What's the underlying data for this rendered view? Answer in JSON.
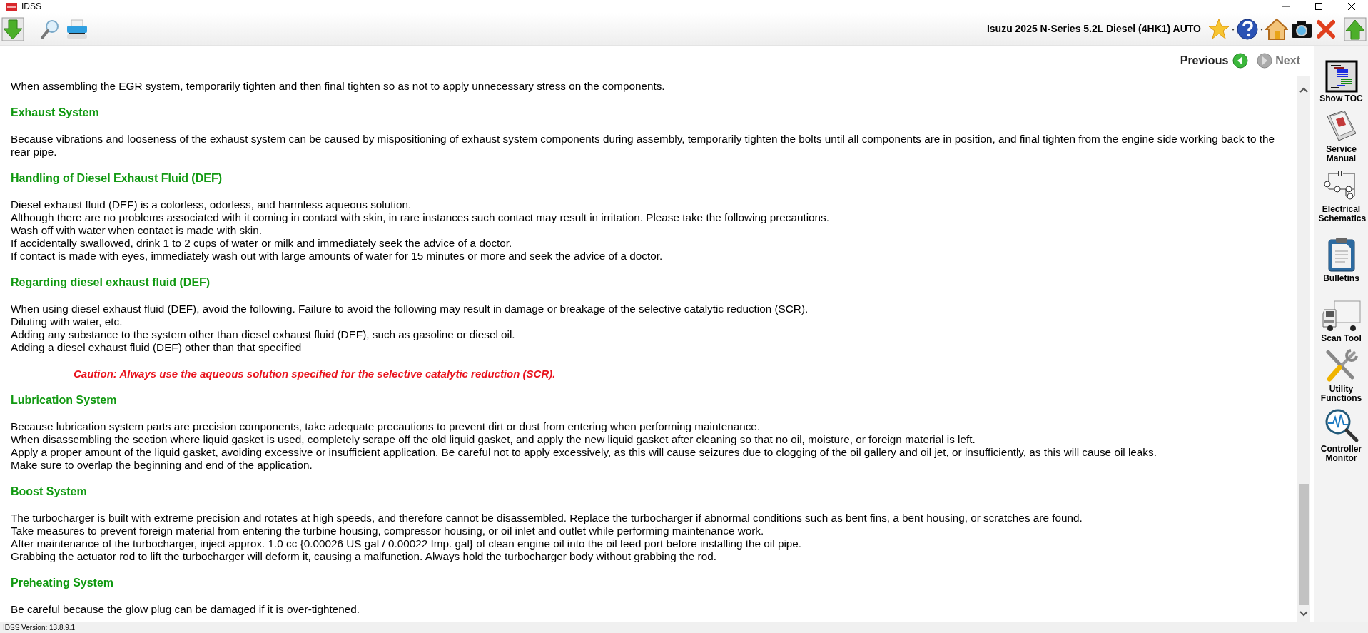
{
  "window": {
    "title": "IDSS"
  },
  "toolbar": {
    "vehicle": "Isuzu 2025 N-Series 5.2L Diesel (4HK1) AUTO"
  },
  "nav": {
    "previous": "Previous",
    "next": "Next",
    "next_disabled": true
  },
  "content": [
    {
      "kind": "paragraph",
      "lines": [
        "When assembling the EGR system, temporarily tighten and then final tighten so as not to apply unnecessary stress on the components."
      ]
    },
    {
      "kind": "heading",
      "text": "Exhaust System"
    },
    {
      "kind": "paragraph",
      "lines": [
        "Because vibrations and looseness of the exhaust system can be caused by mispositioning of exhaust system components during assembly, temporarily tighten the bolts until all components are in position, and final tighten from the engine side working back to the rear pipe."
      ]
    },
    {
      "kind": "heading",
      "text": "Handling of Diesel Exhaust Fluid (DEF)"
    },
    {
      "kind": "paragraph",
      "lines": [
        "Diesel exhaust fluid (DEF) is a colorless, odorless, and harmless aqueous solution.",
        "Although there are no problems associated with it coming in contact with skin, in rare instances such contact may result in irritation. Please take the following precautions.",
        "Wash off with water when contact is made with skin.",
        "If accidentally swallowed, drink 1 to 2 cups of water or milk and immediately seek the advice of a doctor.",
        "If contact is made with eyes, immediately wash out with large amounts of water for 15 minutes or more and seek the advice of a doctor."
      ]
    },
    {
      "kind": "heading",
      "text": "Regarding diesel exhaust fluid (DEF)"
    },
    {
      "kind": "paragraph",
      "lines": [
        "When using diesel exhaust fluid (DEF), avoid the following. Failure to avoid the following may result in damage or breakage of the selective catalytic reduction (SCR).",
        "Diluting with water, etc.",
        "Adding any substance to the system other than diesel exhaust fluid (DEF), such as gasoline or diesel oil.",
        "Adding a diesel exhaust fluid (DEF) other than that specified"
      ]
    },
    {
      "kind": "caution",
      "text": "Caution: Always use the aqueous solution specified for the selective catalytic reduction (SCR)."
    },
    {
      "kind": "heading",
      "text": "Lubrication System"
    },
    {
      "kind": "paragraph",
      "lines": [
        "Because lubrication system parts are precision components, take adequate precautions to prevent dirt or dust from entering when performing maintenance.",
        "When disassembling the section where liquid gasket is used, completely scrape off the old liquid gasket, and apply the new liquid gasket after cleaning so that no oil, moisture, or foreign material is left.",
        "Apply a proper amount of the liquid gasket, avoiding excessive or insufficient application. Be careful not to apply excessively, as this will cause seizures due to clogging of the oil gallery and oil jet, or insufficiently, as this will cause oil leaks.",
        "Make sure to overlap the beginning and end of the application."
      ]
    },
    {
      "kind": "heading",
      "text": "Boost System"
    },
    {
      "kind": "paragraph",
      "lines": [
        "The turbocharger is built with extreme precision and rotates at high speeds, and therefore cannot be disassembled. Replace the turbocharger if abnormal conditions such as bent fins, a bent housing, or scratches are found.",
        "Take measures to prevent foreign material from entering the turbine housing, compressor housing, or oil inlet and outlet while performing maintenance work.",
        "After maintenance of the turbocharger, inject approx. 1.0 cc {0.00026 US gal / 0.00022 Imp. gal} of clean engine oil into the oil feed port before installing the oil pipe.",
        "Grabbing the actuator rod to lift the turbocharger will deform it, causing a malfunction. Always hold the turbocharger body without grabbing the rod."
      ]
    },
    {
      "kind": "heading",
      "text": "Preheating System"
    },
    {
      "kind": "paragraph",
      "lines": [
        "Be careful because the glow plug can be damaged if it is over-tightened."
      ]
    }
  ],
  "sidebar": {
    "items": [
      {
        "kind": "toc",
        "label": "Show TOC"
      },
      {
        "kind": "manual",
        "label": "Service Manual"
      },
      {
        "kind": "schematics",
        "label": "Electrical Schematics"
      },
      {
        "kind": "bulletins",
        "label": "Bulletins"
      },
      {
        "kind": "scan",
        "label": "Scan Tool"
      },
      {
        "kind": "utility",
        "label": "Utility Functions"
      },
      {
        "kind": "monitor",
        "label": "Controller Monitor"
      }
    ]
  },
  "status_bar": {
    "version": "IDSS Version: 13.8.9.1"
  }
}
